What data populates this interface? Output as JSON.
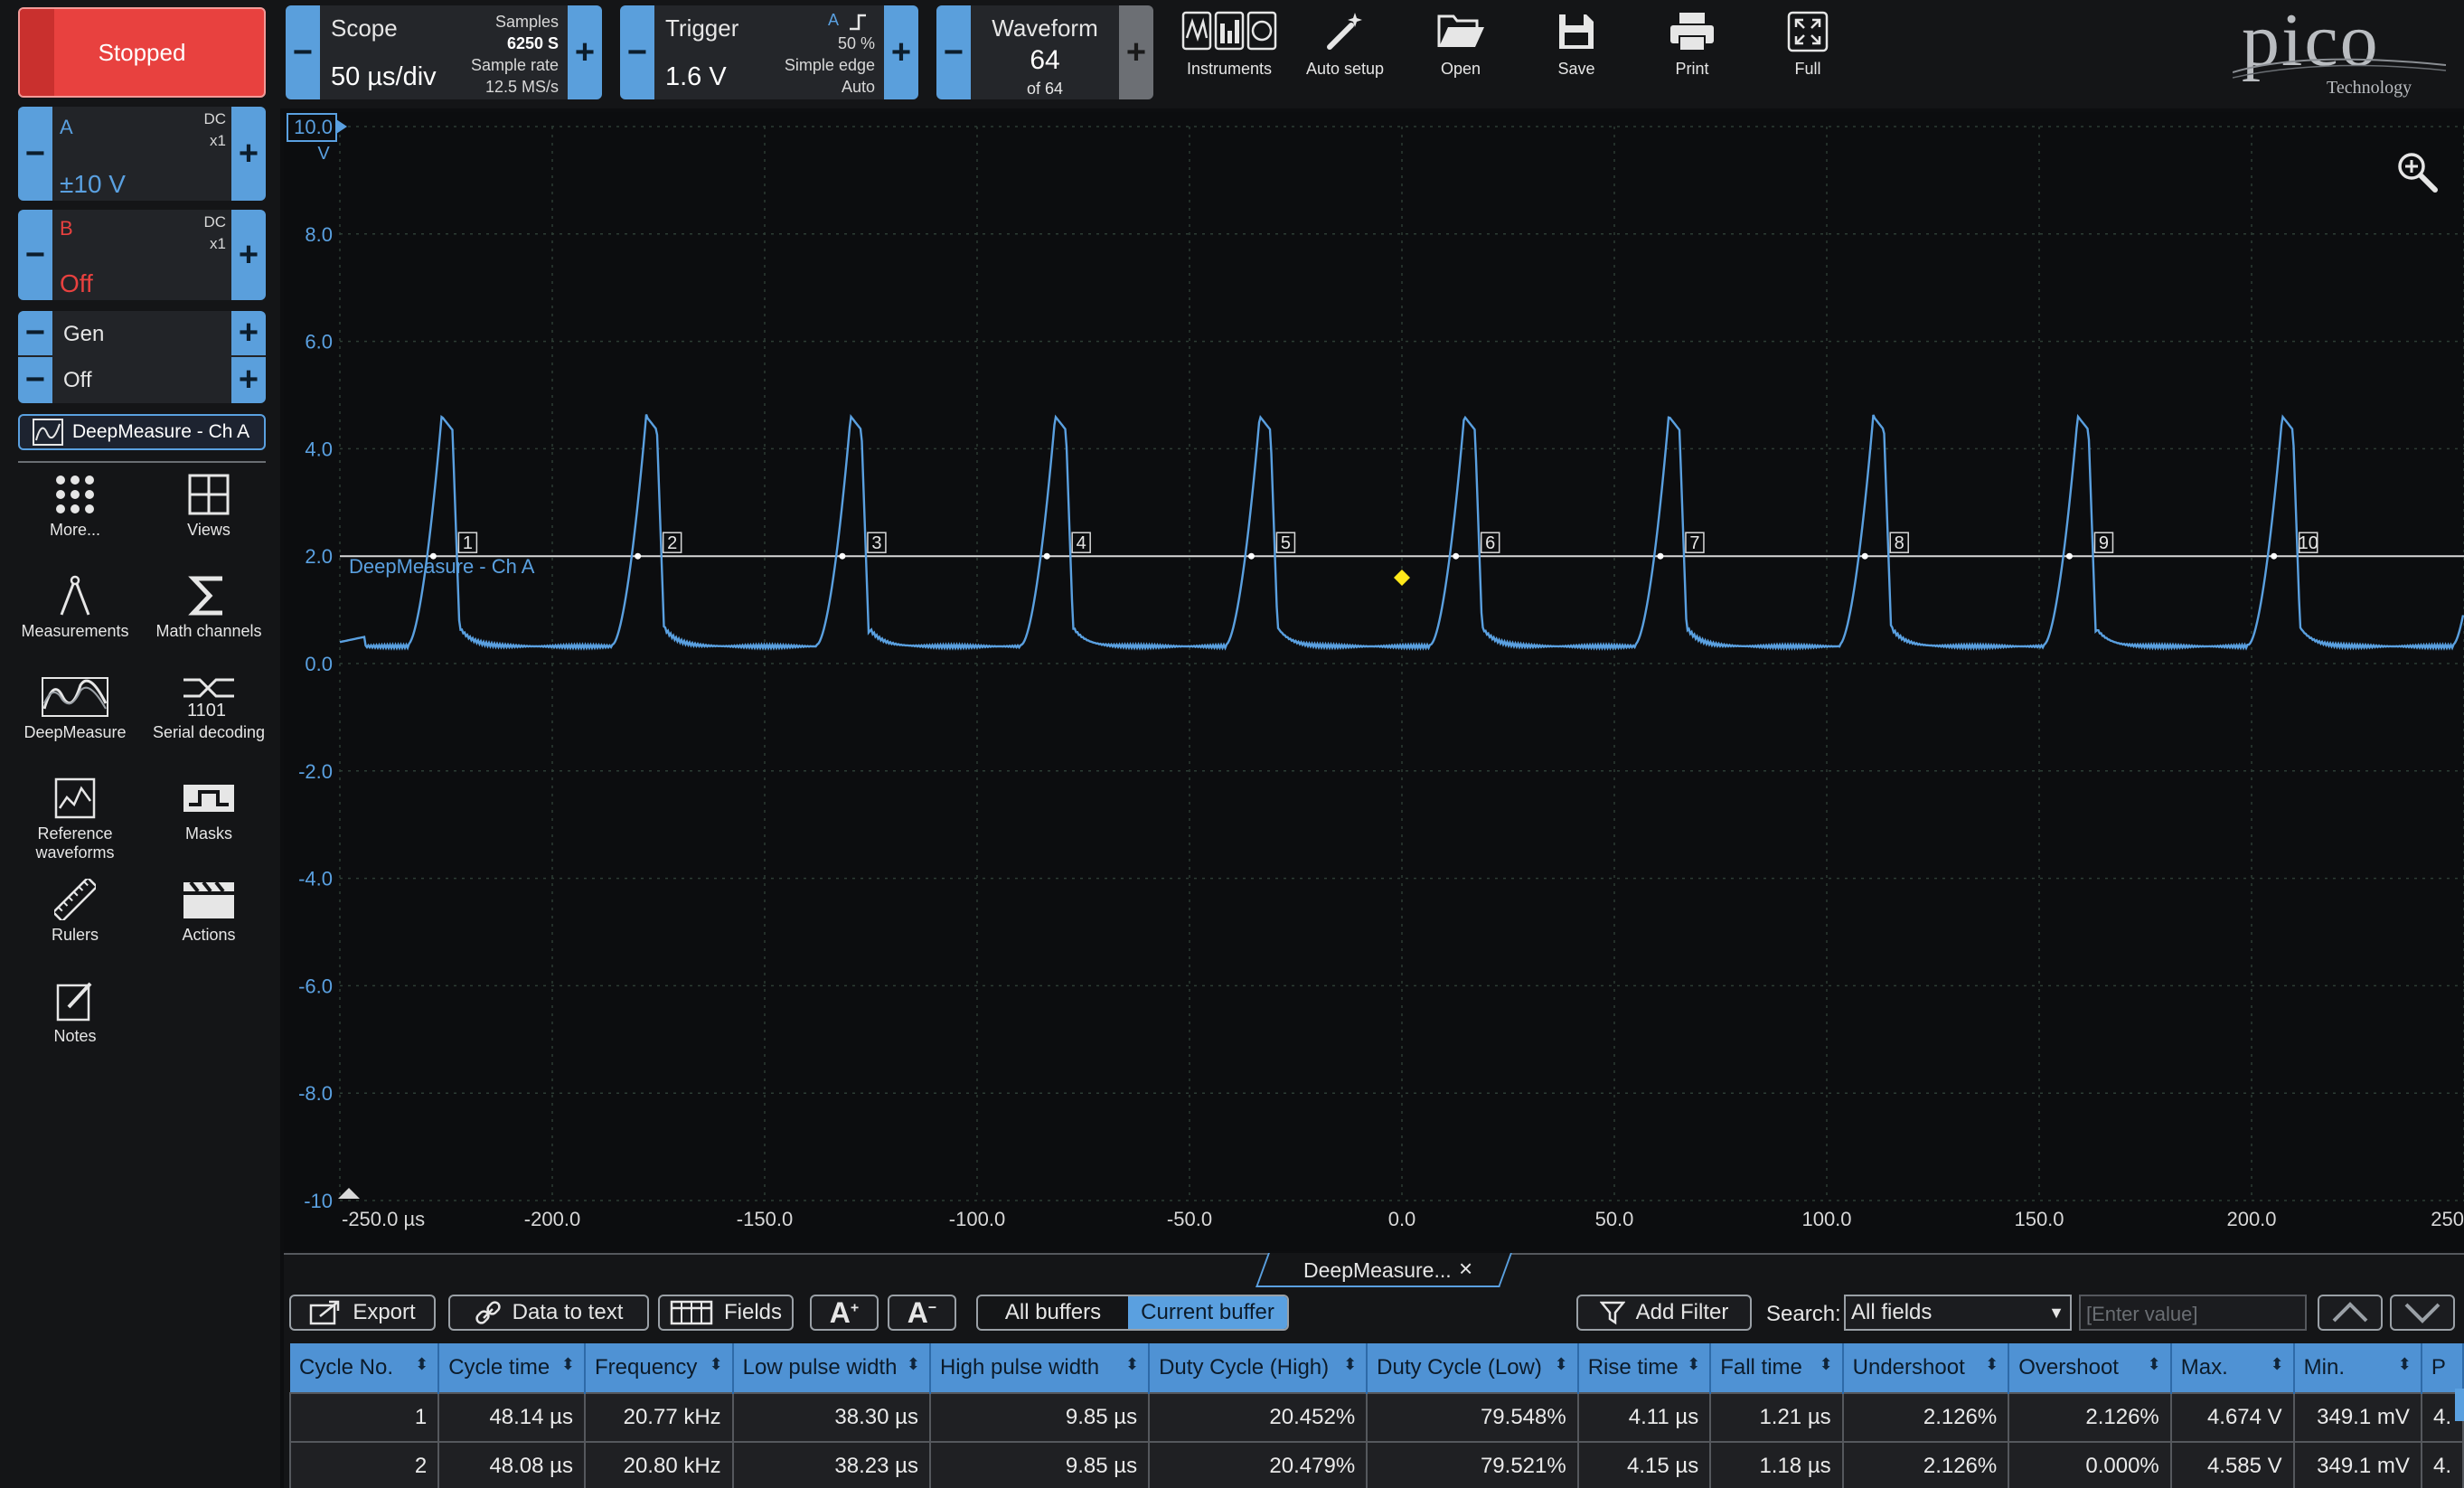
{
  "run_button": {
    "label": "Stopped"
  },
  "scope": {
    "title": "Scope",
    "timebase": "50 µs/div",
    "samples_label": "Samples",
    "samples_value": "6250 S",
    "rate_label": "Sample rate",
    "rate_value": "12.5 MS/s"
  },
  "trigger": {
    "title": "Trigger",
    "level": "1.6 V",
    "channel": "A",
    "position": "50 %",
    "type": "Simple edge",
    "mode": "Auto"
  },
  "waveform": {
    "title": "Waveform",
    "current": "64",
    "of": "of 64"
  },
  "toolbar": {
    "instruments": "Instruments",
    "auto_setup": "Auto setup",
    "open": "Open",
    "save": "Save",
    "print": "Print",
    "full": "Full"
  },
  "logo": {
    "name": "pico",
    "sub": "Technology"
  },
  "channel_a": {
    "name": "A",
    "coupling": "DC",
    "probe": "x1",
    "range": "±10 V"
  },
  "channel_b": {
    "name": "B",
    "coupling": "DC",
    "probe": "x1",
    "range": "Off"
  },
  "gen": {
    "label": "Gen",
    "state": "Off"
  },
  "deepmeasure_tab": {
    "label": "DeepMeasure - Ch A"
  },
  "side_tools": {
    "more": "More...",
    "views": "Views",
    "measurements": "Measurements",
    "math": "Math channels",
    "deepmeasure": "DeepMeasure",
    "serial": "Serial decoding",
    "reference": "Reference waveforms",
    "masks": "Masks",
    "rulers": "Rulers",
    "actions": "Actions",
    "notes": "Notes"
  },
  "plot": {
    "y_unit": "V",
    "y_ticks": [
      "10.0",
      "8.0",
      "6.0",
      "4.0",
      "2.0",
      "0.0",
      "-2.0",
      "-4.0",
      "-6.0",
      "-8.0",
      "-10"
    ],
    "x_ticks": [
      "-250.0 µs",
      "-200.0",
      "-150.0",
      "-100.0",
      "-50.0",
      "0.0",
      "50.0",
      "100.0",
      "150.0",
      "200.0",
      "250"
    ],
    "threshold_label": "DeepMeasure - Ch A",
    "cycle_markers": [
      "1",
      "2",
      "3",
      "4",
      "5",
      "6",
      "7",
      "8",
      "9",
      "10"
    ],
    "trace_color": "#5aa0e0"
  },
  "bottom": {
    "tab_label": "DeepMeasure...",
    "export": "Export",
    "data_to_text": "Data to text",
    "fields": "Fields",
    "all_buffers": "All buffers",
    "current_buffer": "Current buffer",
    "add_filter": "Add Filter",
    "search_label": "Search:",
    "search_scope": "All fields",
    "search_placeholder": "[Enter value]"
  },
  "table": {
    "columns": [
      "Cycle No.",
      "Cycle time",
      "Frequency",
      "Low pulse width",
      "High pulse width",
      "Duty Cycle (High)",
      "Duty Cycle (Low)",
      "Rise time",
      "Fall time",
      "Undershoot",
      "Overshoot",
      "Max.",
      "Min.",
      "P"
    ],
    "rows": [
      [
        "1",
        "48.14 µs",
        "20.77 kHz",
        "38.30 µs",
        "9.85 µs",
        "20.452%",
        "79.548%",
        "4.11 µs",
        "1.21 µs",
        "2.126%",
        "2.126%",
        "4.674 V",
        "349.1 mV",
        "4."
      ],
      [
        "2",
        "48.08 µs",
        "20.80 kHz",
        "38.23 µs",
        "9.85 µs",
        "20.479%",
        "79.521%",
        "4.15 µs",
        "1.18 µs",
        "2.126%",
        "0.000%",
        "4.585 V",
        "349.1 mV",
        "4."
      ]
    ]
  }
}
